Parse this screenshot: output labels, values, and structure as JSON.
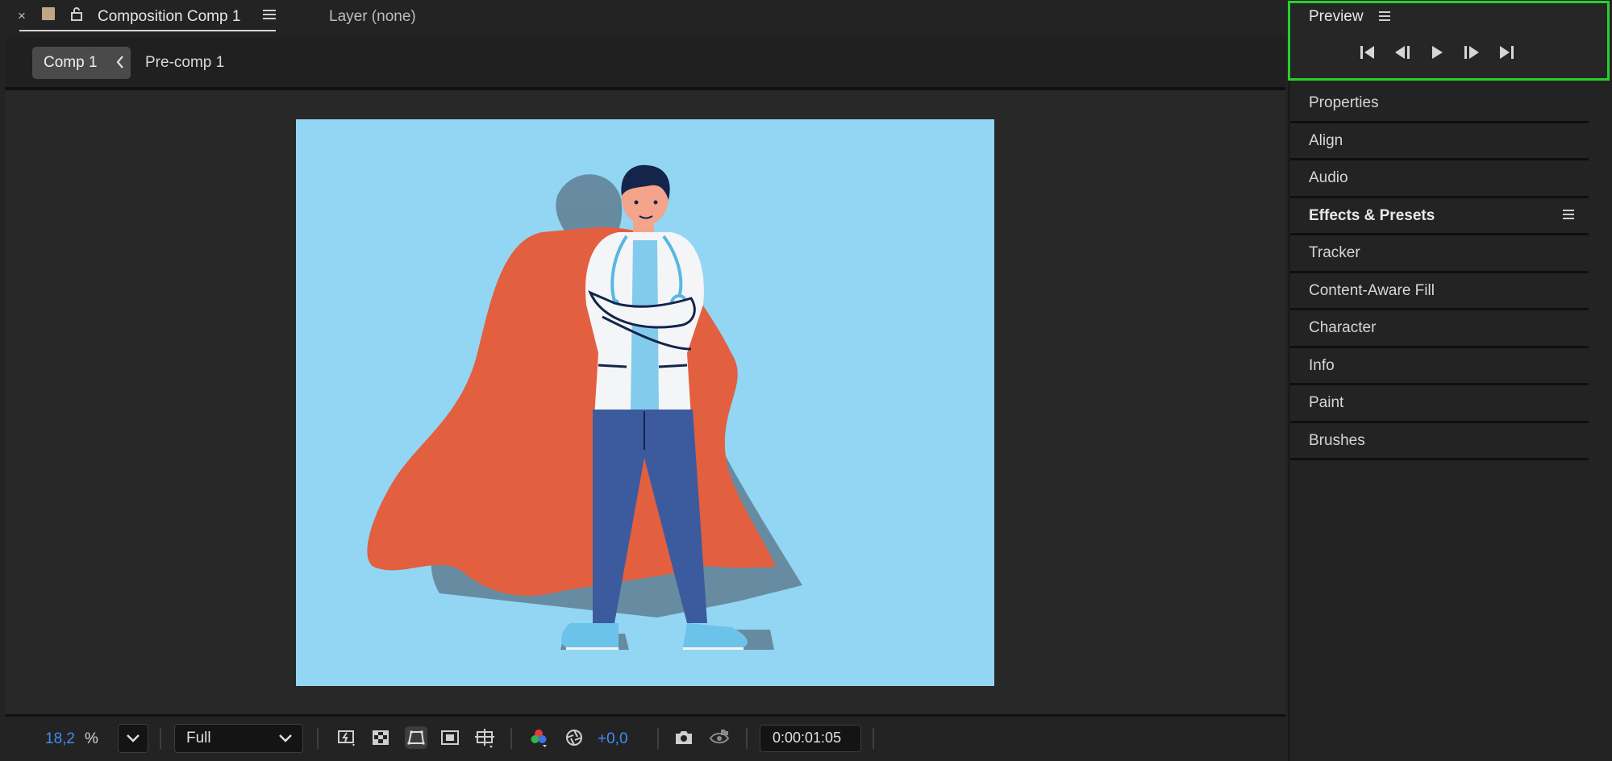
{
  "composition_tab": {
    "close_glyph": "×",
    "title": "Composition Comp 1",
    "swatch_color": "#c0a684"
  },
  "layer_tab": {
    "title": "Layer (none)"
  },
  "breadcrumb": {
    "items": [
      "Comp 1",
      "Pre-comp 1"
    ]
  },
  "viewer": {
    "background_color": "#92d6f3"
  },
  "bottom_bar": {
    "zoom_value": "18,2",
    "zoom_unit": "%",
    "resolution": "Full",
    "exposure": "+0,0",
    "timecode": "0:00:01:05",
    "tools": [
      "fast-previews-icon",
      "transparency-grid-icon",
      "mask-visibility-icon",
      "region-of-interest-icon",
      "grid-guides-icon",
      "color-channel-icon",
      "reset-exposure-icon",
      "snapshot-icon",
      "show-snapshot-icon"
    ]
  },
  "right_panel": {
    "preview": {
      "title": "Preview",
      "buttons": [
        "first-frame-icon",
        "previous-frame-icon",
        "play-icon",
        "next-frame-icon",
        "last-frame-icon"
      ],
      "highlight_color": "#25d12c"
    },
    "items": [
      {
        "label": "Properties",
        "bold": false
      },
      {
        "label": "Align",
        "bold": false
      },
      {
        "label": "Audio",
        "bold": false
      },
      {
        "label": "Effects & Presets",
        "bold": true
      },
      {
        "label": "Tracker",
        "bold": false
      },
      {
        "label": "Content-Aware Fill",
        "bold": false
      },
      {
        "label": "Character",
        "bold": false
      },
      {
        "label": "Info",
        "bold": false
      },
      {
        "label": "Paint",
        "bold": false
      },
      {
        "label": "Brushes",
        "bold": false
      }
    ]
  }
}
